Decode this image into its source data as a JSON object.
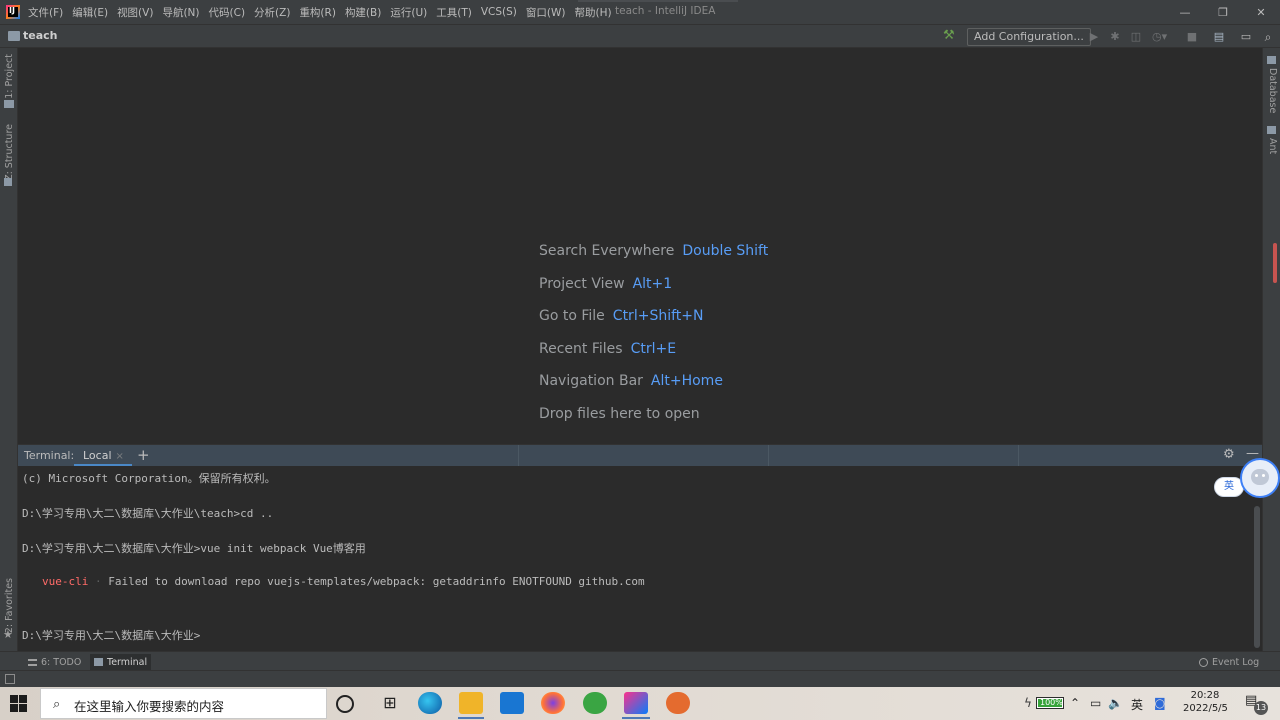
{
  "menubar": {
    "items": [
      "文件(F)",
      "编辑(E)",
      "视图(V)",
      "导航(N)",
      "代码(C)",
      "分析(Z)",
      "重构(R)",
      "构建(B)",
      "运行(U)",
      "工具(T)",
      "VCS(S)",
      "窗口(W)",
      "帮助(H)"
    ],
    "window_title": "teach - IntelliJ IDEA",
    "controls": {
      "minimize": "—",
      "restore": "❐",
      "close": "✕"
    }
  },
  "navbar": {
    "project_name": "teach",
    "add_configuration": "Add Configuration...",
    "icons": [
      "hammer-icon",
      "run-icon",
      "debug-icon",
      "coverage-icon",
      "profile-icon",
      "stop-icon",
      "project-structure-icon",
      "layout-icon",
      "search-icon"
    ]
  },
  "left_tools": {
    "project": "1: Project",
    "structure": "Z: Structure",
    "favorites": "2: Favorites"
  },
  "right_tools": {
    "database": "Database",
    "ant": "Ant"
  },
  "editor_hints": [
    {
      "label": "Search Everywhere",
      "key": "Double Shift"
    },
    {
      "label": "Project View",
      "key": "Alt+1"
    },
    {
      "label": "Go to File",
      "key": "Ctrl+Shift+N"
    },
    {
      "label": "Recent Files",
      "key": "Ctrl+E"
    },
    {
      "label": "Navigation Bar",
      "key": "Alt+Home"
    },
    {
      "label": "Drop files here to open",
      "key": ""
    }
  ],
  "terminal": {
    "label": "Terminal:",
    "tab": "Local",
    "tab_close": "×",
    "add": "+",
    "lines": {
      "copyright": "(c) Microsoft Corporation。保留所有权利。",
      "cmd1": "D:\\学习专用\\大二\\数据库\\大作业\\teach>cd ..",
      "cmd2": "D:\\学习专用\\大二\\数据库\\大作业>vue init webpack Vue博客用",
      "err_prefix": "vue-cli",
      "err_dot": " · ",
      "err_msg": "Failed to download repo vuejs-templates/webpack: getaddrinfo ENOTFOUND github.com",
      "prompt": "D:\\学习专用\\大二\\数据库\\大作业>"
    }
  },
  "ime": {
    "lang": "英"
  },
  "bottom_tabs": {
    "todo": "6: TODO",
    "terminal": "Terminal",
    "event_log": "Event Log"
  },
  "taskbar": {
    "search_placeholder": "在这里输入你要搜索的内容",
    "clock_time": "20:28",
    "clock_date": "2022/5/5",
    "battery": "100%",
    "ime": "英",
    "notifications": "13"
  },
  "colors": {
    "accent": "#589df6",
    "error": "#ff6b68",
    "tab_underline": "#4a88c7"
  }
}
